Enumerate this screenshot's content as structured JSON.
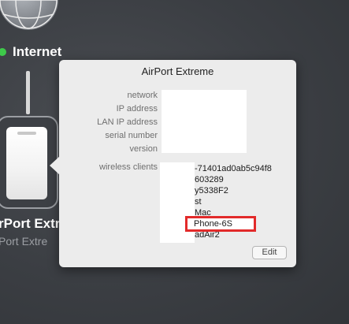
{
  "sidebar": {
    "internet_label": "Internet",
    "device_name": "rPort Extr",
    "device_subtitle": "Port Extre"
  },
  "popover": {
    "title": "AirPort Extreme",
    "fields": [
      "network",
      "IP address",
      "LAN IP address",
      "serial number",
      "version",
      "wireless clients"
    ],
    "clients": [
      "-71401ad0ab5c94f8",
      "603289",
      "y5338F2",
      "st",
      "Mac"
    ],
    "highlighted_client": "Phone-6S",
    "last_client": "adAir2",
    "edit_button": "Edit"
  },
  "colors": {
    "status_dot": "#3ec94a",
    "highlight_border": "#e22a2a",
    "background": "#3b3e43"
  },
  "icons": [
    "globe-icon",
    "airport-device-icon"
  ]
}
